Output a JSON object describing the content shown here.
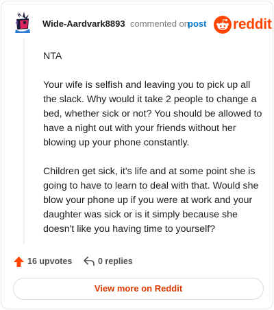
{
  "header": {
    "author": "Wide-Aardvark8893",
    "commented_on": "commented on",
    "post_link": "post",
    "logo_text": "reddit"
  },
  "comment": {
    "paragraphs": [
      "NTA",
      "Your wife is selfish and leaving you to pick up all the slack. Why would it take 2 people to change a bed, whether sick or not? You should be allowed to have a night out with your friends without her blowing up your phone constantly.",
      "Children get sick, it's life and at some point she is going to have to learn to deal with that. Would she blow your phone up if you were at work and your daughter was sick or is it simply because she doesn't like you having time to yourself?"
    ]
  },
  "footer": {
    "upvotes": "16 upvotes",
    "replies": "0 replies",
    "view_more": "View more on Reddit"
  },
  "colors": {
    "brand": "#ff4500",
    "link": "#0079d3",
    "view_more": "#d93a00"
  }
}
